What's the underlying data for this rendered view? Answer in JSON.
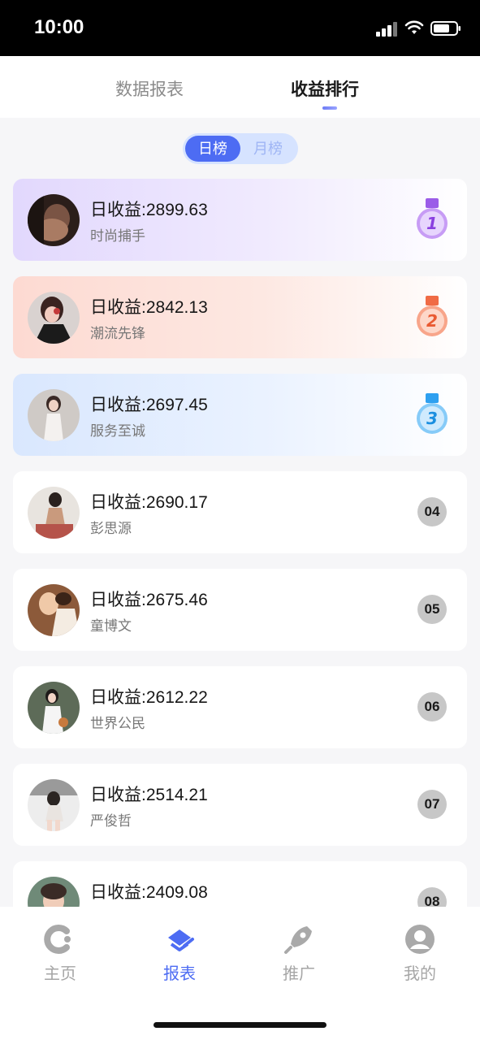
{
  "status_bar": {
    "time": "10:00"
  },
  "top_tabs": [
    {
      "label": "数据报表",
      "active": false
    },
    {
      "label": "收益排行",
      "active": true
    }
  ],
  "toggle": {
    "options": [
      "日榜",
      "月榜"
    ],
    "selected": "日榜"
  },
  "ranking": [
    {
      "rank": "1",
      "income": "日收益:2899.63",
      "name": "时尚捕手",
      "medal": "purple"
    },
    {
      "rank": "2",
      "income": "日收益:2842.13",
      "name": "潮流先锋",
      "medal": "orange"
    },
    {
      "rank": "3",
      "income": "日收益:2697.45",
      "name": "服务至诚",
      "medal": "blue"
    },
    {
      "rank": "04",
      "income": "日收益:2690.17",
      "name": "彭思源"
    },
    {
      "rank": "05",
      "income": "日收益:2675.46",
      "name": "童博文"
    },
    {
      "rank": "06",
      "income": "日收益:2612.22",
      "name": "世界公民"
    },
    {
      "rank": "07",
      "income": "日收益:2514.21",
      "name": "严俊哲"
    },
    {
      "rank": "08",
      "income": "日收益:2409.08",
      "name": ""
    }
  ],
  "bottom_nav": [
    {
      "label": "主页",
      "icon": "home-c-icon",
      "active": false
    },
    {
      "label": "报表",
      "icon": "report-hand-icon",
      "active": true
    },
    {
      "label": "推广",
      "icon": "rocket-icon",
      "active": false
    },
    {
      "label": "我的",
      "icon": "profile-icon",
      "active": false
    }
  ],
  "colors": {
    "accent": "#4d6cf3",
    "rank1_bg": "#e5dcfd",
    "rank2_bg": "#fde0d9",
    "rank3_bg": "#deeafe",
    "rank_badge": "#c7c7c7"
  }
}
